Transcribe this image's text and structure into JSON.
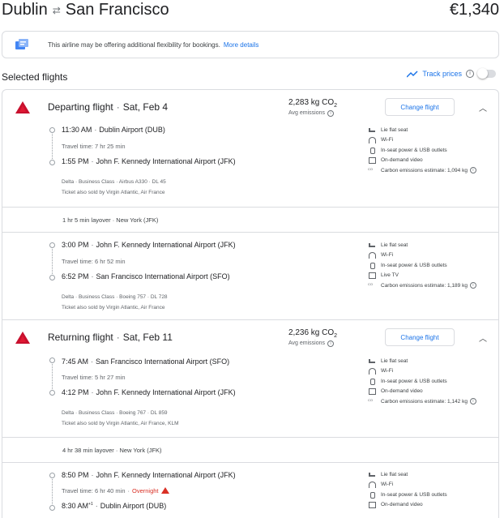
{
  "header": {
    "origin": "Dublin",
    "destination": "San Francisco",
    "price": "€1,340"
  },
  "notice": {
    "text": "This airline may be offering additional flexibility for bookings.",
    "link": "More details"
  },
  "selected": {
    "title": "Selected flights",
    "track_label": "Track prices",
    "track_enabled": false
  },
  "departing": {
    "title": "Departing flight",
    "date": "Sat, Feb 4",
    "co2": "2,283 kg CO",
    "co2_sub": "2",
    "avg": "Avg emissions",
    "change": "Change flight",
    "seg1": {
      "dep_time": "11:30 AM",
      "dep_airport": "Dublin Airport (DUB)",
      "travel": "Travel time: 7 hr 25 min",
      "arr_time": "1:55 PM",
      "arr_airport": "John F. Kennedy International Airport (JFK)",
      "details": "Delta · Business Class · Airbus A330 · DL 45",
      "sold": "Ticket also sold by Virgin Atlantic, Air France",
      "amenities": [
        "Lie flat seat",
        "Wi-Fi",
        "In-seat power & USB outlets",
        "On-demand video",
        "Carbon emissions estimate: 1,094 kg"
      ]
    },
    "layover": "1 hr 5 min layover · New York (JFK)",
    "seg2": {
      "dep_time": "3:00 PM",
      "dep_airport": "John F. Kennedy International Airport (JFK)",
      "travel": "Travel time: 6 hr 52 min",
      "arr_time": "6:52 PM",
      "arr_airport": "San Francisco International Airport (SFO)",
      "details": "Delta · Business Class · Boeing 757 · DL 728",
      "sold": "Ticket also sold by Virgin Atlantic, Air France",
      "amenities": [
        "Lie flat seat",
        "Wi-Fi",
        "In-seat power & USB outlets",
        "Live TV",
        "Carbon emissions estimate: 1,189 kg"
      ]
    }
  },
  "returning": {
    "title": "Returning flight",
    "date": "Sat, Feb 11",
    "co2": "2,236 kg CO",
    "co2_sub": "2",
    "avg": "Avg emissions",
    "change": "Change flight",
    "seg1": {
      "dep_time": "7:45 AM",
      "dep_airport": "San Francisco International Airport (SFO)",
      "travel": "Travel time: 5 hr 27 min",
      "arr_time": "4:12 PM",
      "arr_airport": "John F. Kennedy International Airport (JFK)",
      "details": "Delta · Business Class · Boeing 767 · DL 859",
      "sold": "Ticket also sold by Virgin Atlantic, Air France, KLM",
      "amenities": [
        "Lie flat seat",
        "Wi-Fi",
        "In-seat power & USB outlets",
        "On-demand video",
        "Carbon emissions estimate: 1,142 kg"
      ]
    },
    "layover": "4 hr 38 min layover · New York (JFK)",
    "seg2": {
      "dep_time": "8:50 PM",
      "dep_airport": "John F. Kennedy International Airport (JFK)",
      "travel": "Travel time: 6 hr 40 min",
      "overnight": "Overnight",
      "arr_time": "8:30 AM",
      "arr_sup": "+1",
      "arr_airport": "Dublin Airport (DUB)",
      "amenities": [
        "Lie flat seat",
        "Wi-Fi",
        "In-seat power & USB outlets",
        "On-demand video"
      ]
    }
  },
  "colors": {
    "accent": "#1a73e8",
    "delta_red": "#c8102e",
    "warning": "#d93025"
  },
  "icons": [
    "swap-arrows-icon",
    "flex-booking-icon",
    "trending-up-icon",
    "info-icon",
    "delta-logo",
    "chevron-up-icon",
    "seat-icon",
    "wifi-icon",
    "power-icon",
    "video-icon",
    "tv-icon",
    "co2-icon",
    "warning-icon"
  ]
}
